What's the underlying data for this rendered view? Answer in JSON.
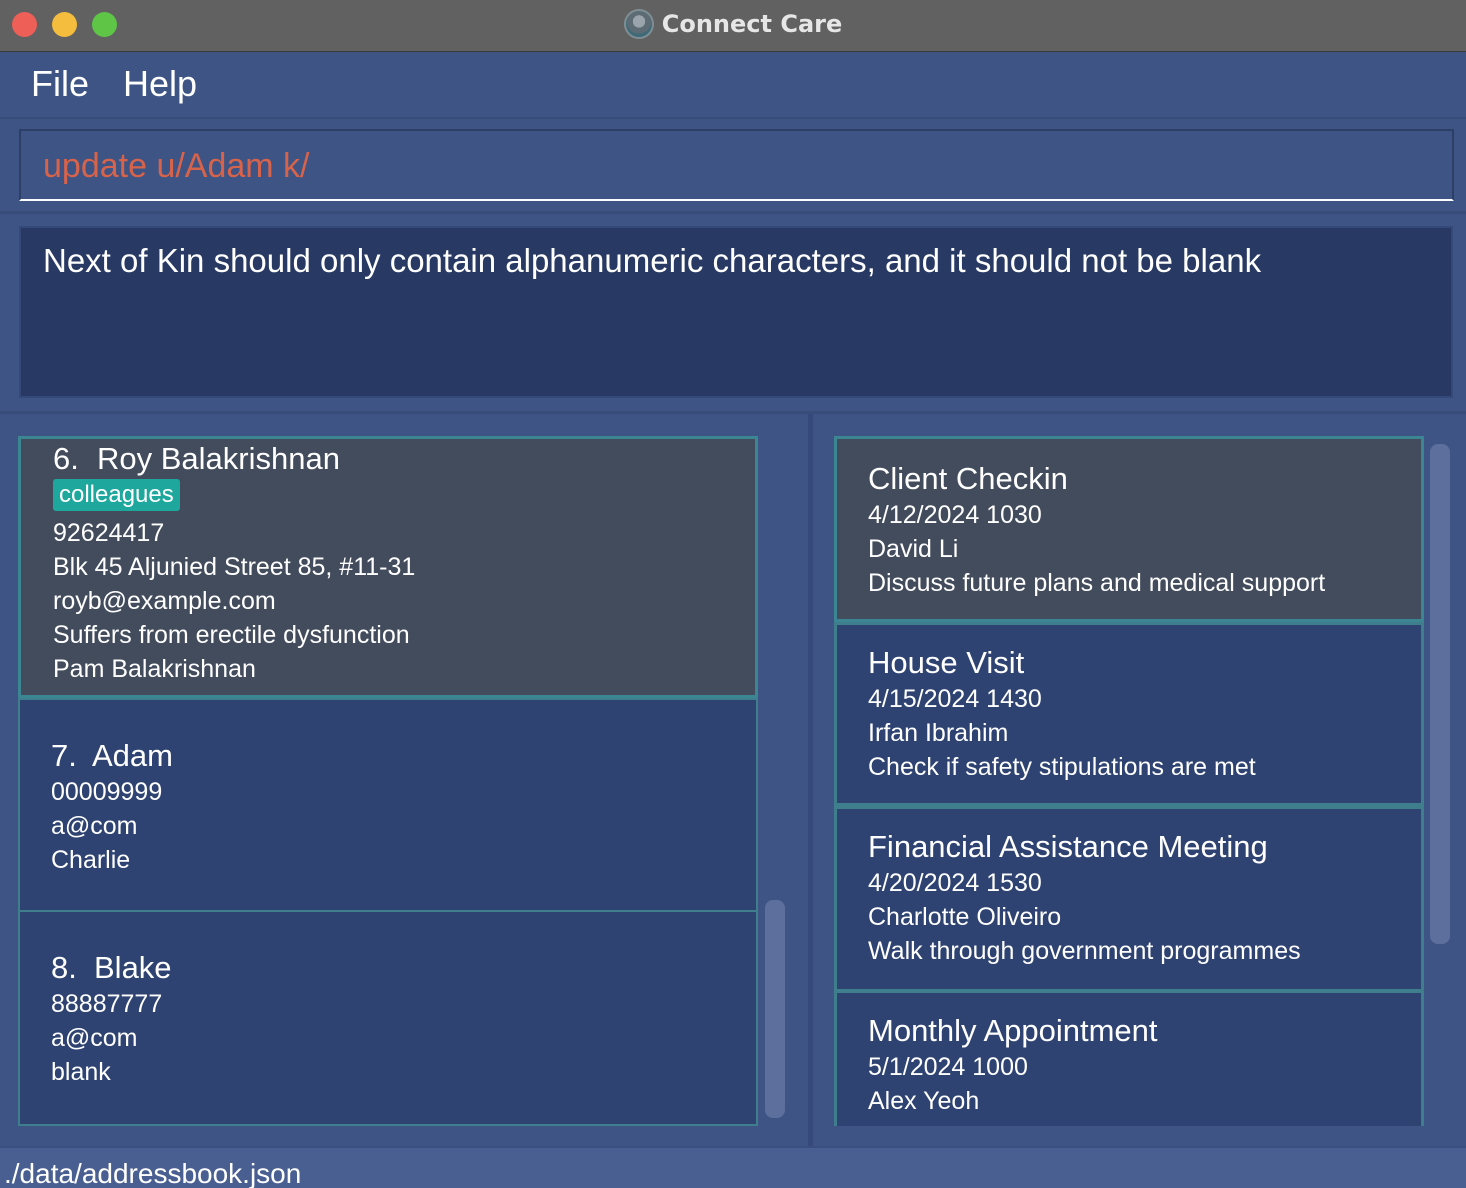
{
  "window": {
    "title": "Connect Care",
    "icon": "app-logo-icon"
  },
  "menu": {
    "file": "File",
    "help": "Help"
  },
  "command": {
    "value": "update u/Adam k/"
  },
  "result": {
    "message": "Next of Kin should only contain alphanumeric characters, and it should not be blank"
  },
  "persons": [
    {
      "index": "6.",
      "name": "Roy Balakrishnan",
      "tag": "colleagues",
      "phone": "92624417",
      "address": "Blk 45 Aljunied Street 85, #11-31",
      "email": "royb@example.com",
      "note": "Suffers from erectile dysfunction",
      "kin": "Pam Balakrishnan"
    },
    {
      "index": "7.",
      "name": "Adam",
      "phone": "00009999",
      "email": "a@com",
      "kin": "Charlie"
    },
    {
      "index": "8.",
      "name": "Blake",
      "phone": "88887777",
      "email": "a@com",
      "kin": "blank"
    }
  ],
  "appointments": [
    {
      "title": "Client Checkin",
      "datetime": "4/12/2024 1030",
      "person": "David Li",
      "description": "Discuss future plans and medical support"
    },
    {
      "title": "House Visit",
      "datetime": "4/15/2024 1430",
      "person": "Irfan Ibrahim",
      "description": "Check if safety stipulations are met"
    },
    {
      "title": "Financial Assistance Meeting",
      "datetime": "4/20/2024 1530",
      "person": "Charlotte Oliveiro",
      "description": "Walk through government programmes"
    },
    {
      "title": "Monthly Appointment",
      "datetime": "5/1/2024 1000",
      "person": "Alex Yeoh"
    }
  ],
  "status": {
    "path": "./data/addressbook.json"
  }
}
